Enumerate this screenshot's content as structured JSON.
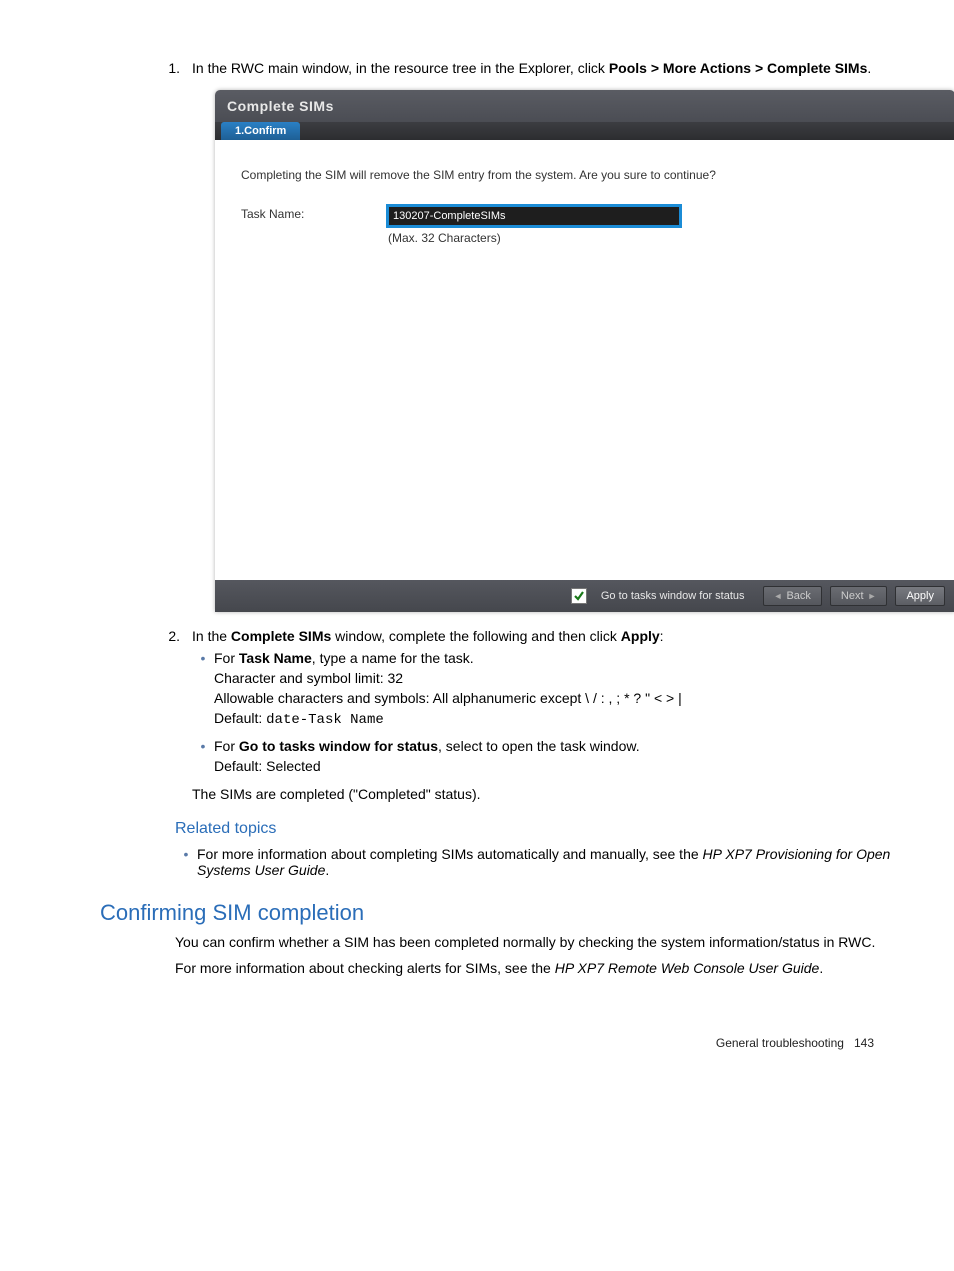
{
  "steps": {
    "s1": {
      "num": "1.",
      "pre": "In the RWC main window, in the resource tree in the Explorer, click ",
      "bold": "Pools > More Actions > Complete SIMs",
      "post": "."
    },
    "s2": {
      "num": "2.",
      "pre": "In the ",
      "b1": "Complete SIMs",
      "mid": " window, complete the following and then click ",
      "b2": "Apply",
      "post": ":"
    }
  },
  "dialog": {
    "title": "Complete SIMs",
    "tab": "1.Confirm",
    "message": "Completing the SIM will remove the SIM entry from the system. Are you sure to continue?",
    "task_label": "Task Name:",
    "task_value": "130207-CompleteSIMs",
    "task_hint": "(Max. 32 Characters)",
    "footer": {
      "chk_label": "Go to tasks window for status",
      "back": "Back",
      "next": "Next",
      "apply": "Apply"
    }
  },
  "bullets": {
    "b1": {
      "l1a": "For ",
      "l1b": "Task Name",
      "l1c": ", type a name for the task.",
      "l2": "Character and symbol limit: 32",
      "l3": "Allowable characters and symbols: All alphanumeric except \\ / : , ; * ? \" < > |",
      "l4a": "Default: ",
      "l4b": "date-Task Name"
    },
    "b2": {
      "l1a": "For ",
      "l1b": "Go to tasks window for status",
      "l1c": ", select to open the task window.",
      "l2": "Default: Selected"
    },
    "after": "The SIMs are completed (\"Completed\" status)."
  },
  "related": {
    "heading": "Related topics",
    "item_pre": "For more information about completing SIMs automatically and manually, see the ",
    "item_it": "HP XP7 Provisioning for Open Systems User Guide",
    "item_post": "."
  },
  "section": {
    "heading": "Confirming SIM completion",
    "p1": "You can confirm whether a SIM has been completed normally by checking the system information/status in RWC.",
    "p2a": "For more information about checking alerts for SIMs, see the ",
    "p2b": "HP XP7 Remote Web Console User Guide",
    "p2c": "."
  },
  "footer": {
    "label": "General troubleshooting",
    "page": "143"
  }
}
